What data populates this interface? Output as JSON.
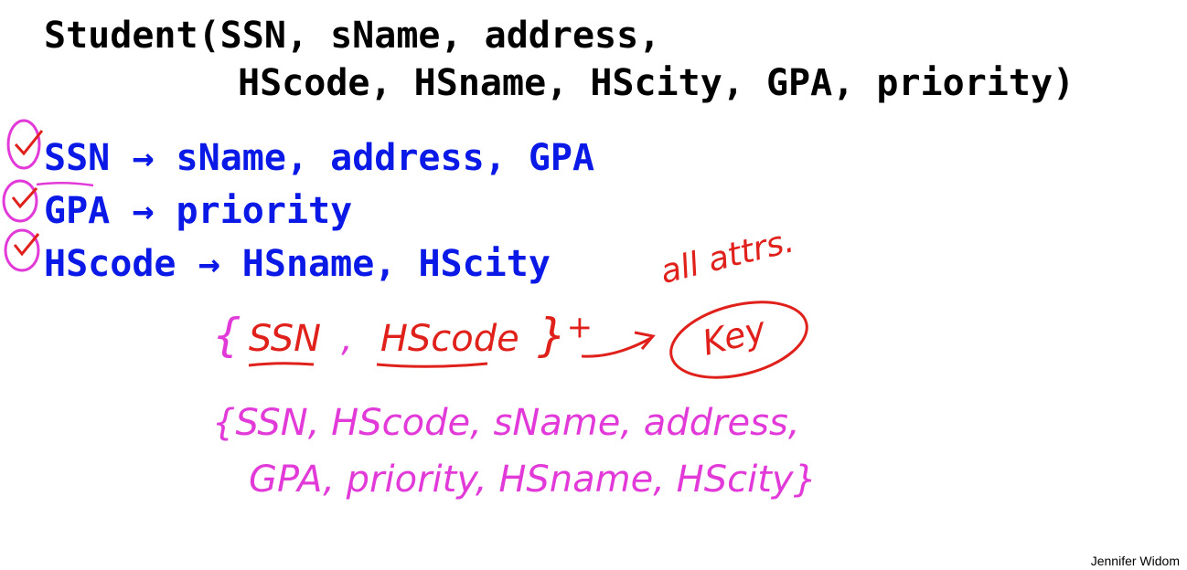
{
  "schema": {
    "line1": "Student(SSN, sName, address,",
    "line2": "HScode, HSname, HScity, GPA, priority)"
  },
  "fds": [
    {
      "lhs": "SSN",
      "arrow": "→",
      "rhs": "sName, address, GPA"
    },
    {
      "lhs": "GPA",
      "arrow": "→",
      "rhs": "priority"
    },
    {
      "lhs": "HScode",
      "arrow": "→",
      "rhs": "HSname, HScity"
    }
  ],
  "annotations": {
    "checkmark": "✓",
    "closure": {
      "open_brace": "{",
      "attr1": "SSN",
      "comma": ",",
      "attr2": "HScode",
      "close_brace": "}",
      "plus": "+"
    },
    "all_attrs": "all attrs.",
    "key": "Key",
    "closure_set_line1": "{SSN, HScode, sName, address,",
    "closure_set_line2": "GPA, priority, HSname, HScity}"
  },
  "credit": "Jennifer Widom",
  "colors": {
    "schema_text": "#000000",
    "fd_text": "#0a19e6",
    "red_ink": "#e0201a",
    "pink_ink": "#e23ad8"
  }
}
